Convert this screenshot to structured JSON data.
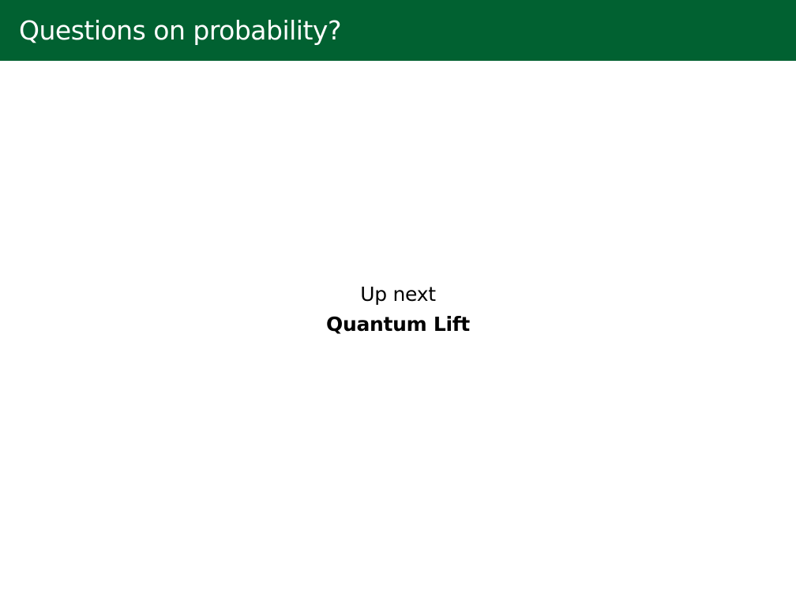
{
  "slide": {
    "title": "Questions on probability?",
    "up_next_label": "Up next",
    "next_topic": "Quantum Lift"
  },
  "colors": {
    "title_bar": "#016131",
    "title_text": "#ffffff",
    "body_text": "#000000",
    "background": "#ffffff"
  }
}
